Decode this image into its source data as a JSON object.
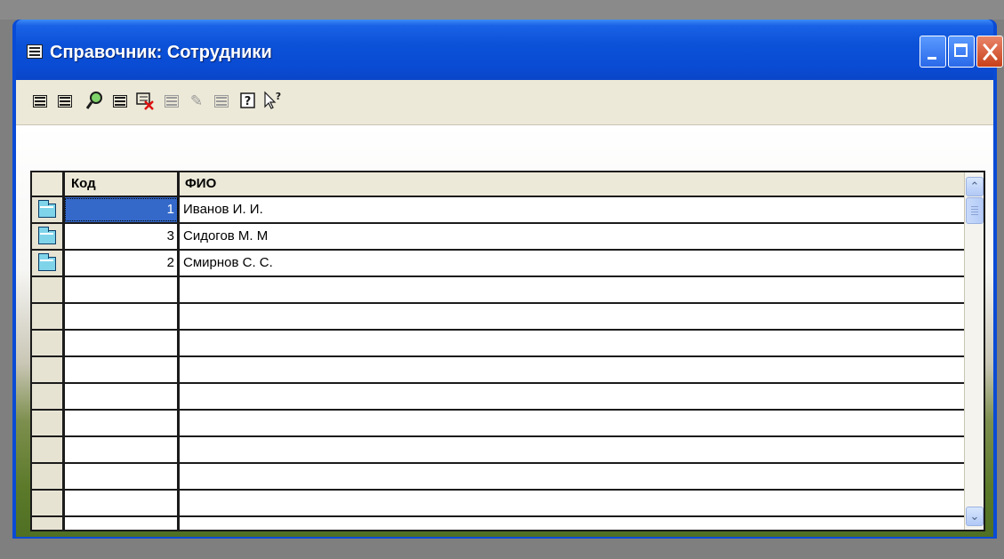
{
  "window": {
    "title": "Справочник: Сотрудники",
    "icon": "document-list-icon"
  },
  "toolbar": {
    "buttons": [
      {
        "name": "new-item",
        "icon": "table-new-icon",
        "enabled": true
      },
      {
        "name": "edit-item",
        "icon": "table-edit-icon",
        "enabled": true
      },
      {
        "name": "find",
        "icon": "search-icon",
        "enabled": true
      },
      {
        "name": "add-row",
        "icon": "row-add-icon",
        "enabled": true
      },
      {
        "name": "delete-row",
        "icon": "row-delete-icon",
        "enabled": true
      },
      {
        "name": "copy-row",
        "icon": "row-copy-icon",
        "enabled": false
      },
      {
        "name": "move",
        "icon": "move-icon",
        "enabled": false
      },
      {
        "name": "paste",
        "icon": "paste-icon",
        "enabled": false
      },
      {
        "name": "help",
        "icon": "help-icon",
        "enabled": true
      },
      {
        "name": "context-help",
        "icon": "whats-this-icon",
        "enabled": true
      }
    ]
  },
  "grid": {
    "columns": [
      "Код",
      "ФИО"
    ],
    "rows": [
      {
        "code": "1",
        "name": "Иванов И. И.",
        "icon": "folder-icon",
        "selected": true
      },
      {
        "code": "3",
        "name": "Сидогов М. М",
        "icon": "folder-icon",
        "selected": false
      },
      {
        "code": "2",
        "name": "Смирнов С. С.",
        "icon": "folder-icon",
        "selected": false
      }
    ],
    "empty_rows": 10
  },
  "scrollbar": {
    "up_glyph": "⌃",
    "down_glyph": "⌄"
  },
  "colors": {
    "titlebar": "#0a4bd6",
    "selection": "#3569c9",
    "close_button": "#c8401a"
  }
}
